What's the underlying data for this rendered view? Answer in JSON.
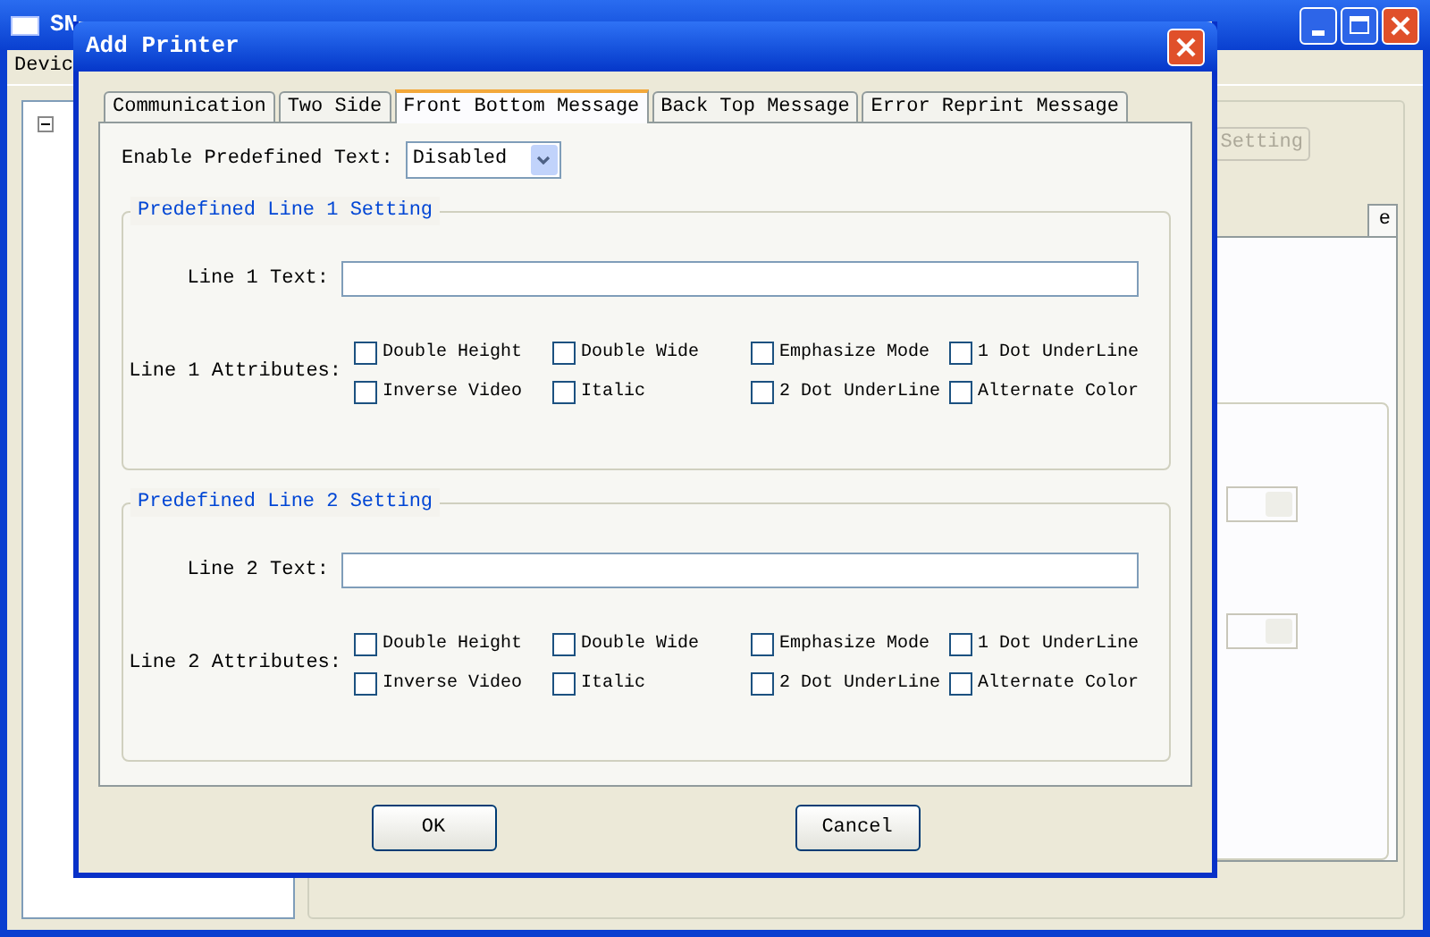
{
  "background_window": {
    "title": "SN",
    "menu": [
      "Devic"
    ],
    "tree": [
      {
        "expanded": true
      }
    ],
    "button": "Setting",
    "tab": "e"
  },
  "dialog": {
    "title": "Add Printer",
    "tabs": [
      {
        "label": "Communication",
        "selected": false
      },
      {
        "label": "Two Side",
        "selected": false
      },
      {
        "label": "Front Bottom Message",
        "selected": true
      },
      {
        "label": "Back Top Message",
        "selected": false
      },
      {
        "label": "Error Reprint Message",
        "selected": false
      }
    ],
    "enable_label": "Enable Predefined Text:",
    "enable_value": "Disabled",
    "groups": [
      {
        "title": "Predefined Line 1 Setting",
        "text_label": "Line 1 Text:",
        "attributes_label": "Line 1 Attributes:",
        "attributes": [
          {
            "label": "Double Height",
            "checked": false
          },
          {
            "label": "Double Wide",
            "checked": false
          },
          {
            "label": "Emphasize Mode",
            "checked": false
          },
          {
            "label": "1 Dot UnderLine",
            "checked": false
          },
          {
            "label": "Inverse Video",
            "checked": false
          },
          {
            "label": "Italic",
            "checked": false
          },
          {
            "label": "2 Dot UnderLine",
            "checked": false
          },
          {
            "label": "Alternate Color",
            "checked": false
          }
        ]
      },
      {
        "title": "Predefined Line 2 Setting",
        "text_label": "Line 2 Text:",
        "attributes_label": "Line 2 Attributes:",
        "attributes": [
          {
            "label": "Double Height",
            "checked": false
          },
          {
            "label": "Double Wide",
            "checked": false
          },
          {
            "label": "Emphasize Mode",
            "checked": false
          },
          {
            "label": "1 Dot UnderLine",
            "checked": false
          },
          {
            "label": "Inverse Video",
            "checked": false
          },
          {
            "label": "Italic",
            "checked": false
          },
          {
            "label": "2 Dot UnderLine",
            "checked": false
          },
          {
            "label": "Alternate Color",
            "checked": false
          }
        ]
      }
    ],
    "buttons": [
      "OK",
      "Cancel"
    ]
  }
}
